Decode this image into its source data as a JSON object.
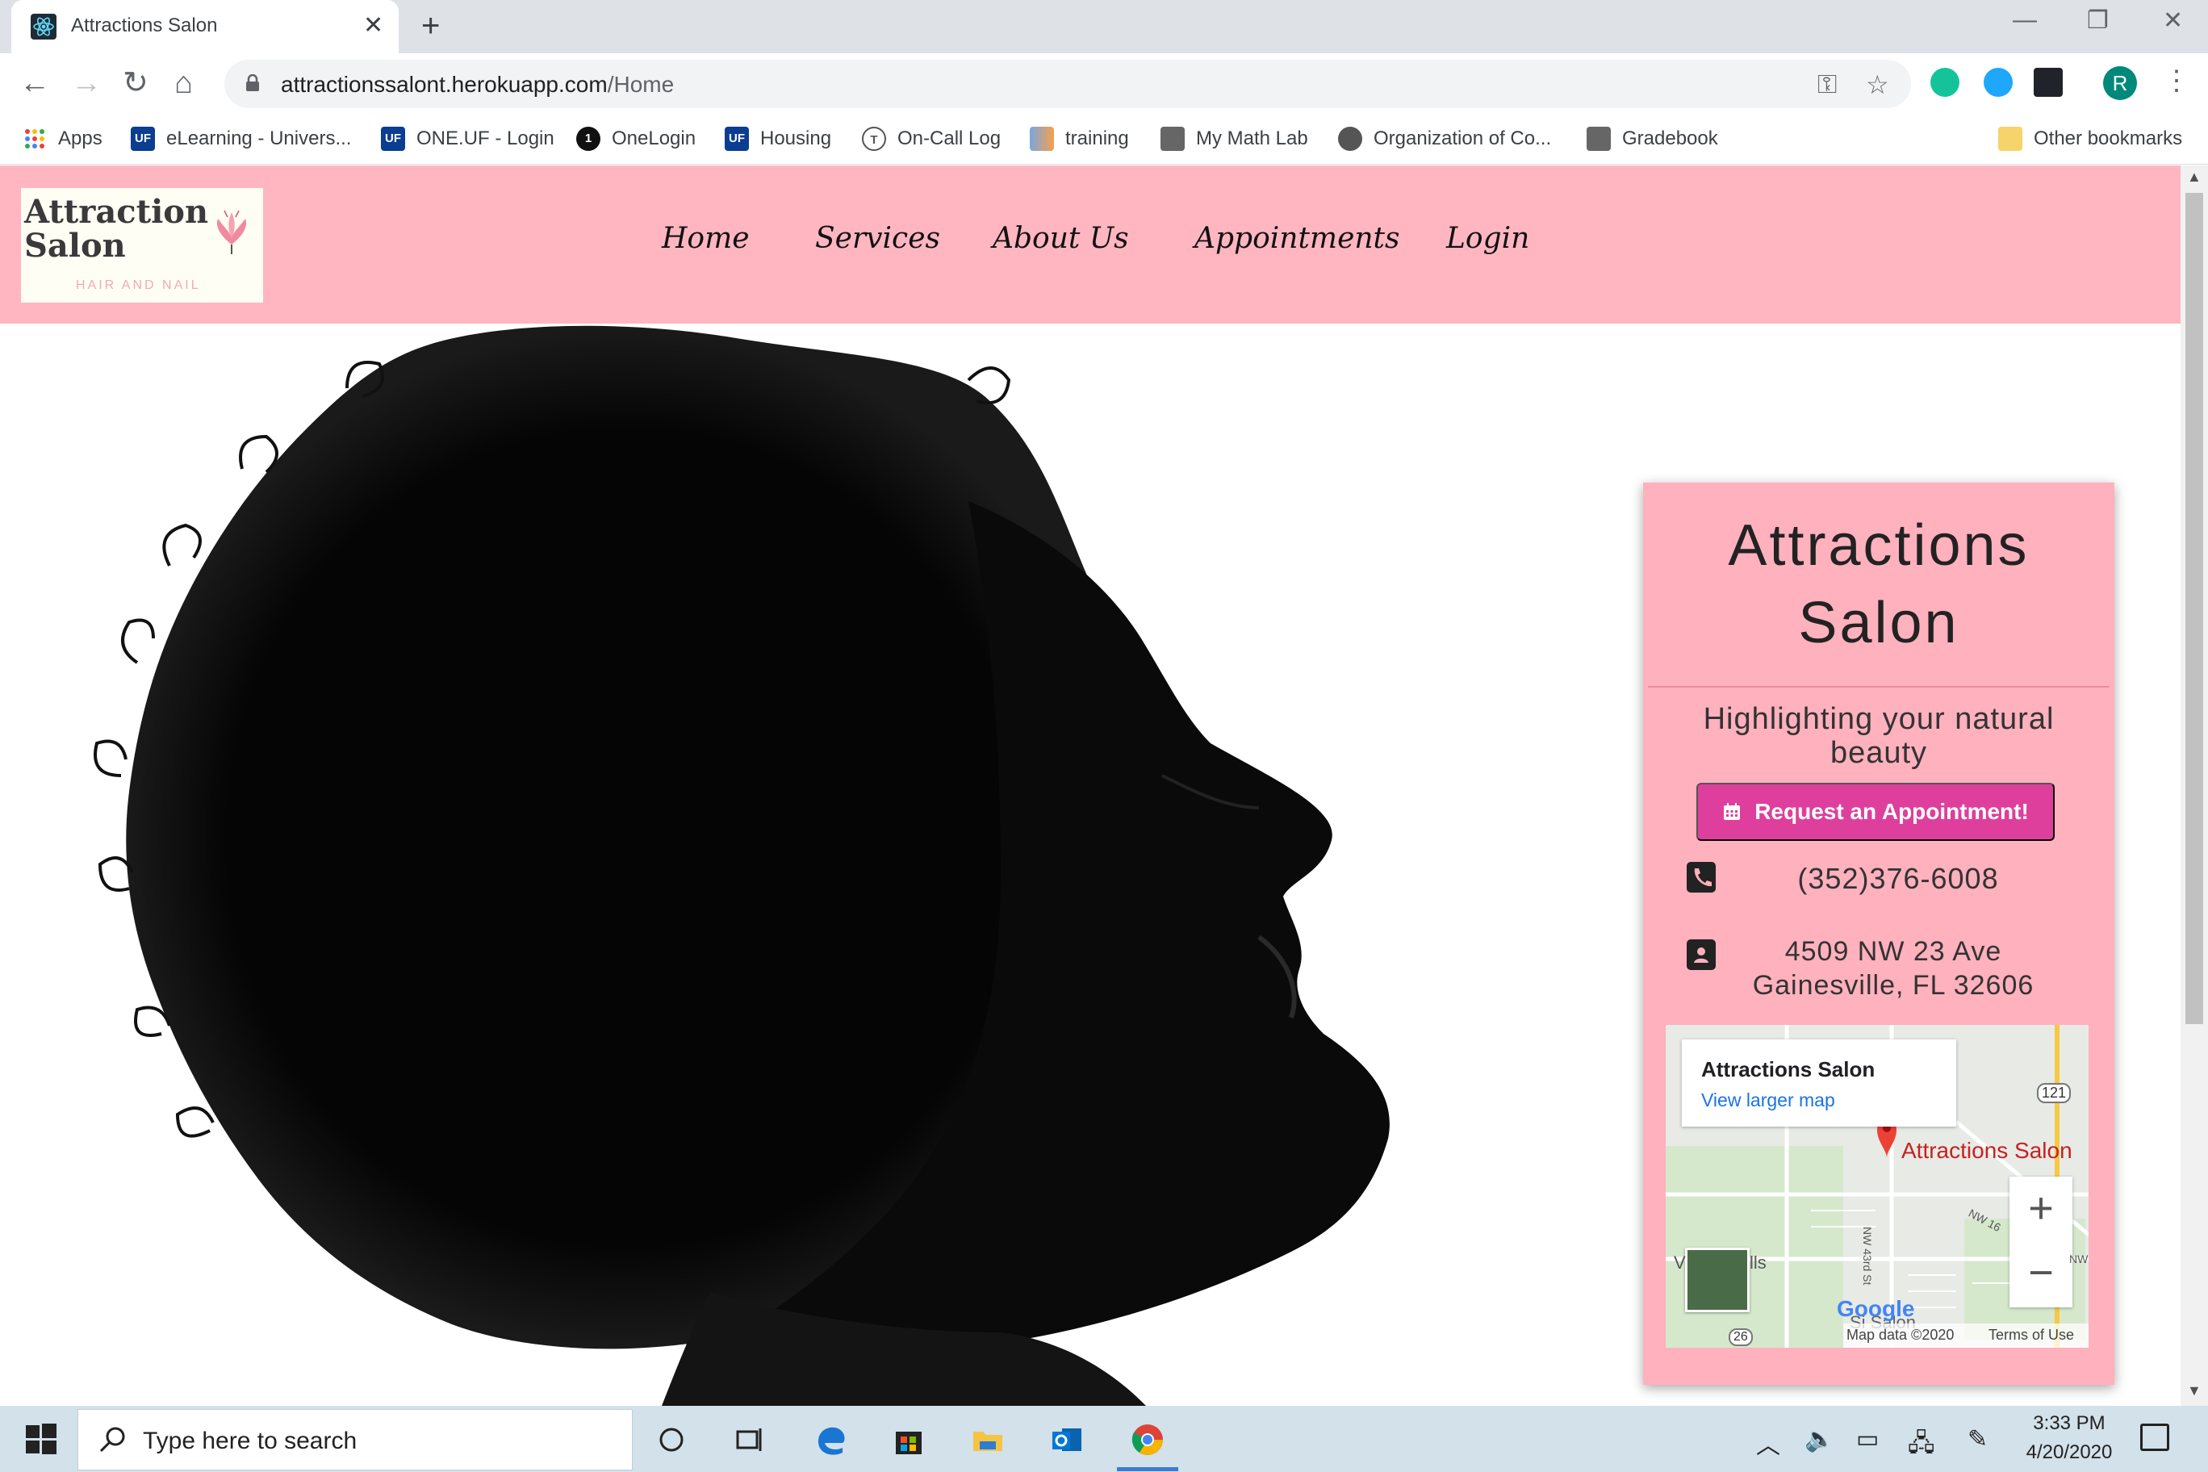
{
  "browser": {
    "tab_title": "Attractions Salon",
    "url_host": "attractionssalont.herokuapp.com",
    "url_path": "/Home",
    "profile_initial": "R"
  },
  "bookmarks": [
    {
      "label": "Apps",
      "icon": "apps-grid-icon"
    },
    {
      "label": "eLearning - Univers...",
      "icon": "uf-icon"
    },
    {
      "label": "ONE.UF - Login",
      "icon": "one-uf-icon"
    },
    {
      "label": "OneLogin",
      "icon": "onelogin-icon"
    },
    {
      "label": "Housing",
      "icon": "uf-icon"
    },
    {
      "label": "On-Call Log",
      "icon": "t-circle-icon"
    },
    {
      "label": "training",
      "icon": "flag-icon"
    },
    {
      "label": "My Math Lab",
      "icon": "book-icon"
    },
    {
      "label": "Organization of Co...",
      "icon": "globe-icon"
    },
    {
      "label": "Gradebook",
      "icon": "book-icon"
    },
    {
      "label": "Other bookmarks",
      "icon": "folder-icon"
    }
  ],
  "site": {
    "logo": {
      "line1": "Attraction",
      "line2": "Salon",
      "sub": "HAIR AND NAIL"
    },
    "nav": [
      "Home",
      "Services",
      "About Us",
      "Appointments",
      "Login"
    ]
  },
  "card": {
    "title_line1": "Attractions",
    "title_line2": "Salon",
    "tagline": "Highlighting your natural beauty",
    "button": "Request an Appointment!",
    "phone": "(352)376-6008",
    "address_line1": "4509 NW 23 Ave",
    "address_line2": "Gainesville, FL 32606"
  },
  "map": {
    "place_name": "Attractions Salon",
    "larger_map_link": "View larger map",
    "pin_label": "Attractions Salon",
    "data_text": "Map data ©2020",
    "terms_text": "Terms of Use",
    "logo_text": "Google",
    "road_121": "121",
    "road_26": "26",
    "street_43": "NW 43rd St",
    "street_16": "NW 16",
    "label_ils": "lls",
    "label_si": "Si Salon",
    "label_nw": "NW",
    "label_v": "V"
  },
  "taskbar": {
    "search_placeholder": "Type here to search",
    "time": "3:33 PM",
    "date": "4/20/2020"
  }
}
